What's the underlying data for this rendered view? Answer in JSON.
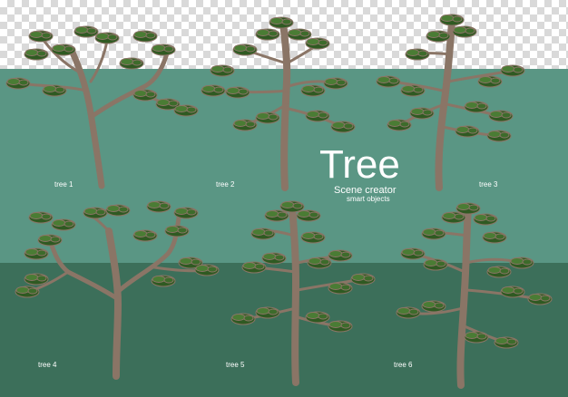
{
  "heading": {
    "title": "Tree",
    "subtitle": "Scene creator",
    "caption": "smart objects"
  },
  "trees": [
    {
      "label": "tree 1"
    },
    {
      "label": "tree 2"
    },
    {
      "label": "tree 3"
    },
    {
      "label": "tree 4"
    },
    {
      "label": "tree 5"
    },
    {
      "label": "tree 6"
    }
  ],
  "colors": {
    "transparent_checker": "#d9d9d9",
    "upper_background": "#5a9684",
    "lower_background": "#3c6f5a",
    "foliage": "#2f5a22",
    "foliage_highlight": "#4a7c34",
    "trunk": "#8a7566",
    "text": "#ffffff"
  }
}
